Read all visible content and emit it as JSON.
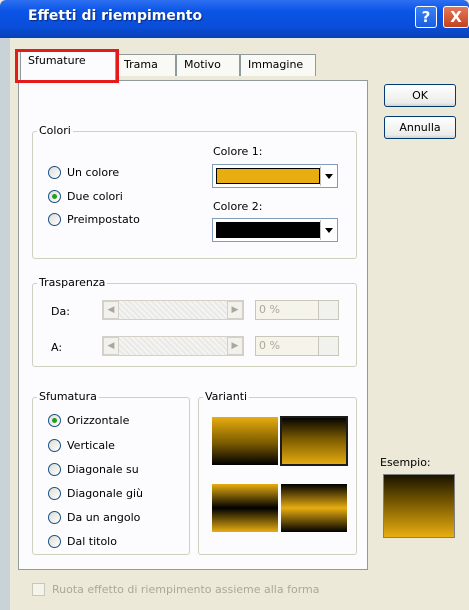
{
  "window": {
    "title": "Effetti di riempimento",
    "help_label": "?",
    "close_label": "X"
  },
  "tabs": [
    {
      "label": "Sfumature",
      "selected": true
    },
    {
      "label": "Trama"
    },
    {
      "label": "Motivo"
    },
    {
      "label": "Immagine"
    }
  ],
  "buttons": {
    "ok": "OK",
    "cancel": "Annulla"
  },
  "colors_group": {
    "title": "Colori",
    "options": [
      "Un colore",
      "Due colori",
      "Preimpostato"
    ],
    "selected": "Due colori",
    "color1_label": "Colore 1:",
    "color1_value": "#e8ad10",
    "color2_label": "Colore 2:",
    "color2_value": "#000000"
  },
  "transparency_group": {
    "title": "Trasparenza",
    "from_label": "Da:",
    "from_value": "0 %",
    "to_label": "A:",
    "to_value": "0 %"
  },
  "gradient_group": {
    "title": "Sfumatura",
    "options": [
      "Orizzontale",
      "Verticale",
      "Diagonale su",
      "Diagonale giù",
      "Da un angolo",
      "Dal titolo"
    ],
    "selected": "Orizzontale"
  },
  "variants_group": {
    "title": "Varianti"
  },
  "sample": {
    "label": "Esempio:"
  },
  "rotate_checkbox": {
    "label": "Ruota effetto di riempimento assieme alla forma",
    "checked": false,
    "enabled": false
  }
}
